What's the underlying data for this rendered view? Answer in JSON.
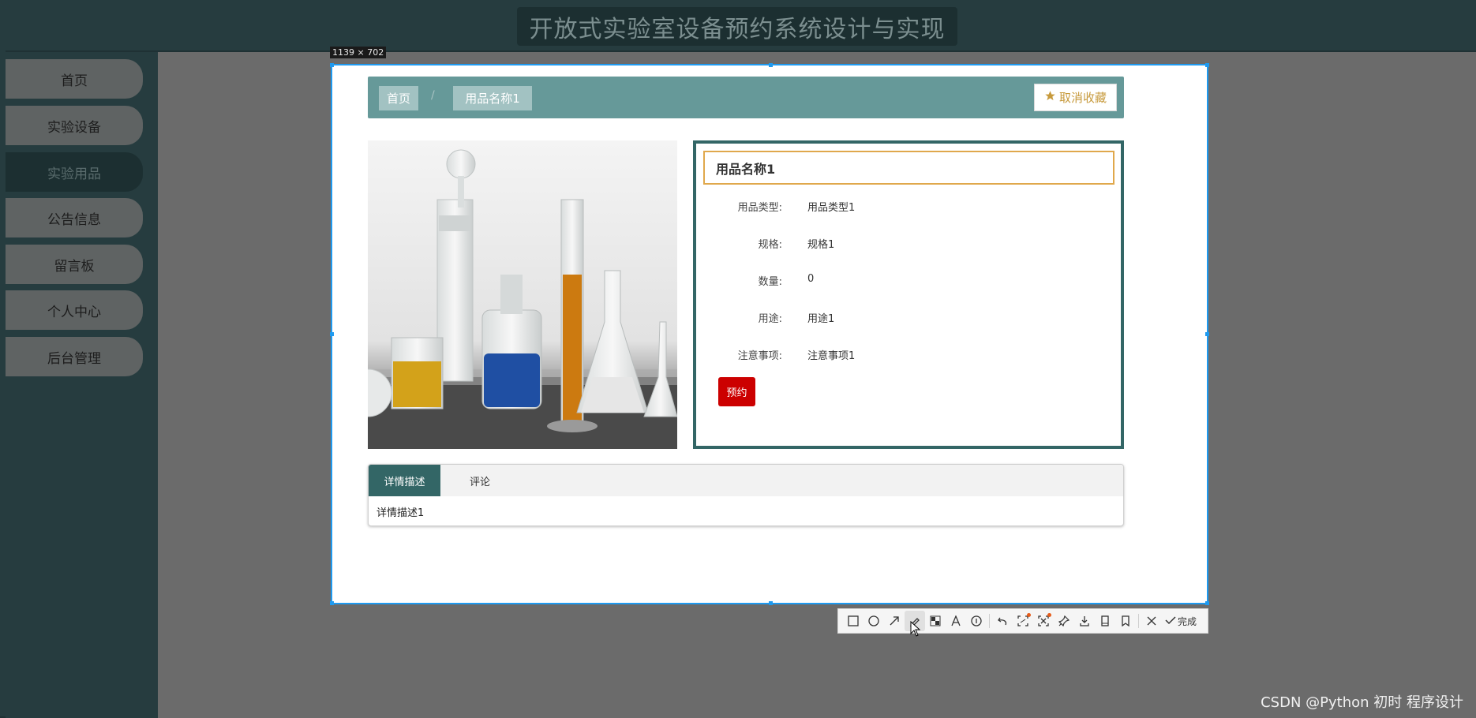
{
  "app": {
    "title": "开放式实验室设备预约系统设计与实现"
  },
  "sidebar": {
    "items": [
      {
        "label": "首页",
        "active": false
      },
      {
        "label": "实验设备",
        "active": false
      },
      {
        "label": "实验用品",
        "active": true
      },
      {
        "label": "公告信息",
        "active": false
      },
      {
        "label": "留言板",
        "active": false
      },
      {
        "label": "个人中心",
        "active": false
      },
      {
        "label": "后台管理",
        "active": false
      }
    ]
  },
  "selection": {
    "size_label": "1139 × 702"
  },
  "breadcrumb": {
    "home": "首页",
    "separator": "/",
    "current": "用品名称1"
  },
  "favorite_button": {
    "label": "取消收藏",
    "icon": "star-icon"
  },
  "product": {
    "name": "用品名称1",
    "fields": [
      {
        "label": "用品类型:",
        "value": "用品类型1"
      },
      {
        "label": "规格:",
        "value": "规格1"
      },
      {
        "label": "数量:",
        "value": "0"
      },
      {
        "label": "用途:",
        "value": "用途1"
      },
      {
        "label": "注意事项:",
        "value": "注意事项1"
      }
    ],
    "reserve_label": "预约"
  },
  "tabs": {
    "items": [
      {
        "label": "详情描述",
        "active": true
      },
      {
        "label": "评论",
        "active": false
      }
    ],
    "content": "详情描述1"
  },
  "toolbar": {
    "tools": [
      "rectangle-icon",
      "ellipse-icon",
      "arrow-icon",
      "pen-icon",
      "mosaic-icon",
      "text-icon",
      "number-icon",
      "undo-icon",
      "ocr-icon",
      "scan-icon",
      "pin-icon",
      "download-icon",
      "long-screenshot-icon",
      "save-icon",
      "close-icon"
    ],
    "done_label": "完成"
  },
  "watermark": "CSDN @Python 初时 程序设计",
  "colors": {
    "header_bg": "#263c3f",
    "teal": "#336666",
    "crumb_bar": "#669999",
    "accent_gold": "#c79a3c",
    "reserve_red": "#cc0000",
    "selection_blue": "#1e9af0"
  }
}
